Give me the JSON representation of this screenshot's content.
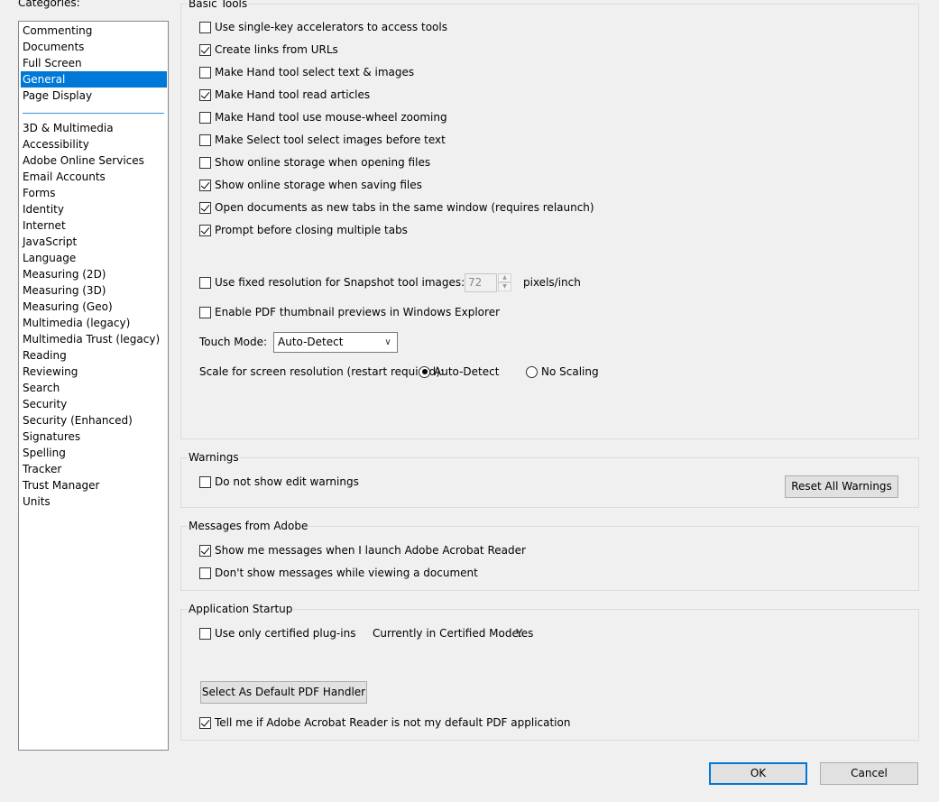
{
  "categories": {
    "label": "Categories:",
    "top_items": [
      "Commenting",
      "Documents",
      "Full Screen",
      "General",
      "Page Display"
    ],
    "selected": "General",
    "items": [
      "3D & Multimedia",
      "Accessibility",
      "Adobe Online Services",
      "Email Accounts",
      "Forms",
      "Identity",
      "Internet",
      "JavaScript",
      "Language",
      "Measuring (2D)",
      "Measuring (3D)",
      "Measuring (Geo)",
      "Multimedia (legacy)",
      "Multimedia Trust (legacy)",
      "Reading",
      "Reviewing",
      "Search",
      "Security",
      "Security (Enhanced)",
      "Signatures",
      "Spelling",
      "Tracker",
      "Trust Manager",
      "Units"
    ]
  },
  "basic_tools": {
    "title": "Basic Tools",
    "options": [
      {
        "label": "Use single-key accelerators to access tools",
        "checked": false
      },
      {
        "label": "Create links from URLs",
        "checked": true
      },
      {
        "label": "Make Hand tool select text & images",
        "checked": false
      },
      {
        "label": "Make Hand tool read articles",
        "checked": true
      },
      {
        "label": "Make Hand tool use mouse-wheel zooming",
        "checked": false
      },
      {
        "label": "Make Select tool select images before text",
        "checked": false
      },
      {
        "label": "Show online storage when opening files",
        "checked": false
      },
      {
        "label": "Show online storage when saving files",
        "checked": true
      },
      {
        "label": "Open documents as new tabs in the same window (requires relaunch)",
        "checked": true
      },
      {
        "label": "Prompt before closing multiple tabs",
        "checked": true
      }
    ],
    "snapshot": {
      "label": "Use fixed resolution for Snapshot tool images:",
      "checked": false,
      "value": "72",
      "unit": "pixels/inch"
    },
    "thumbnail": {
      "label": "Enable PDF thumbnail previews in Windows Explorer",
      "checked": false
    },
    "touch_mode": {
      "label": "Touch Mode:",
      "value": "Auto-Detect"
    },
    "scale": {
      "label": "Scale for screen resolution (restart required):",
      "auto_label": "Auto-Detect",
      "auto_checked": true,
      "none_label": "No Scaling",
      "none_checked": false
    }
  },
  "warnings": {
    "title": "Warnings",
    "option": {
      "label": "Do not show edit warnings",
      "checked": false
    },
    "reset_button": "Reset All Warnings"
  },
  "messages": {
    "title": "Messages from Adobe",
    "options": [
      {
        "label": "Show me messages when I launch Adobe Acrobat Reader",
        "checked": true
      },
      {
        "label": "Don't show messages while viewing a document",
        "checked": false
      }
    ]
  },
  "startup": {
    "title": "Application Startup",
    "certified": {
      "label": "Use only certified plug-ins",
      "checked": false
    },
    "mode_label": "Currently in Certified Mode:",
    "mode_value": "Yes",
    "default_button": "Select As Default PDF Handler",
    "tell_me": {
      "label": "Tell me if Adobe Acrobat Reader is not my default PDF application",
      "checked": true
    }
  },
  "footer": {
    "ok": "OK",
    "cancel": "Cancel"
  }
}
